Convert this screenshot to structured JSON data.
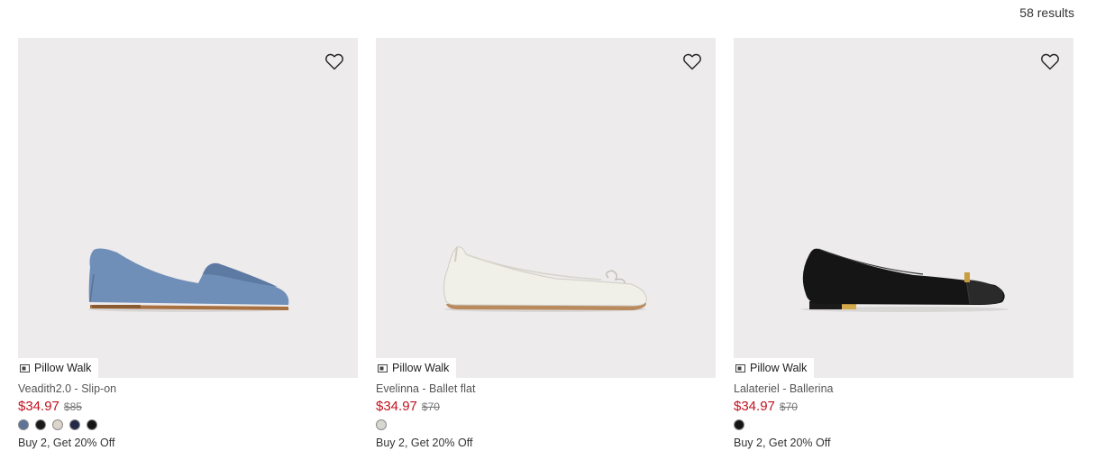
{
  "results": {
    "count_text": "58 results"
  },
  "colors": {
    "sale_price": "#c1121f",
    "image_bg": "#edebec"
  },
  "products": [
    {
      "feature_tag": "Pillow Walk",
      "feature_icon": "pillow-walk-icon",
      "name": "Veadith2.0 - Slip-on",
      "sale_price": "$34.97",
      "original_price": "$85",
      "swatches": [
        "#5d7497",
        "#1a1a1a",
        "#dcd5cc",
        "#232a45",
        "#151515"
      ],
      "promo": "Buy 2, Get 20% Off"
    },
    {
      "feature_tag": "Pillow Walk",
      "feature_icon": "pillow-walk-icon",
      "name": "Evelinna - Ballet flat",
      "sale_price": "$34.97",
      "original_price": "$70",
      "swatches": [
        "#d7d7cf"
      ],
      "promo": "Buy 2, Get 20% Off"
    },
    {
      "feature_tag": "Pillow Walk",
      "feature_icon": "pillow-walk-icon",
      "name": "Lalateriel - Ballerina",
      "sale_price": "$34.97",
      "original_price": "$70",
      "swatches": [
        "#151515"
      ],
      "promo": "Buy 2, Get 20% Off"
    }
  ]
}
